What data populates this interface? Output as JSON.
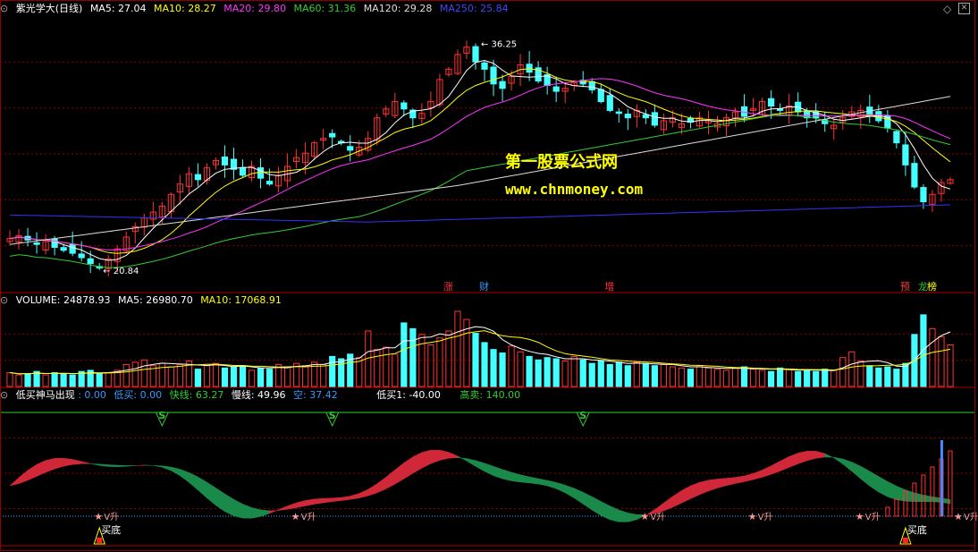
{
  "panel1": {
    "title": "紫光学大(日线)",
    "ma": [
      {
        "label": "MA5: 27.04",
        "color": "#ffffff"
      },
      {
        "label": "MA10: 28.27",
        "color": "#ffff00"
      },
      {
        "label": "MA20: 29.80",
        "color": "#ff33ff"
      },
      {
        "label": "MA60: 31.36",
        "color": "#33cc33"
      },
      {
        "label": "MA120: 29.28",
        "color": "#dddddd"
      },
      {
        "label": "MA250: 25.84",
        "color": "#3333ff"
      }
    ],
    "high_label": "36.25",
    "low_label": "20.84",
    "events": [
      {
        "label": "涨",
        "color": "#ff3333",
        "idx": 49
      },
      {
        "label": "财",
        "color": "#3399ff",
        "idx": 53
      },
      {
        "label": "增",
        "color": "#ff3333",
        "idx": 67
      },
      {
        "label": "预",
        "color": "#ff3333",
        "idx": 100
      },
      {
        "label": "龙",
        "color": "#33cc33",
        "idx": 102
      },
      {
        "label": "榜",
        "color": "#ffff00",
        "idx": 103
      }
    ]
  },
  "panel2": {
    "items": [
      {
        "label": "VOLUME: 24878.93",
        "color": "#ffffff"
      },
      {
        "label": "MA5: 26980.70",
        "color": "#ffffff"
      },
      {
        "label": "MA10: 17068.91",
        "color": "#ffff00"
      }
    ]
  },
  "panel3": {
    "items": [
      {
        "label": "低买神马出现",
        "color": "#ffffff"
      },
      {
        "label": ": 0.00",
        "color": "#3399ff"
      },
      {
        "label": "低买: 0.00",
        "color": "#3399ff"
      },
      {
        "label": "快线: 63.27",
        "color": "#33cc33"
      },
      {
        "label": "慢线: 49.96",
        "color": "#ffffff"
      },
      {
        "label": "空: 37.42",
        "color": "#3399ff"
      },
      {
        "label": "低买1: -40.00",
        "color": "#ffffff"
      },
      {
        "label": "高卖: 140.00",
        "color": "#33cc33"
      }
    ],
    "s_label": "S",
    "s_idx": [
      17,
      36,
      64
    ],
    "v_label": "V升",
    "v_idx": [
      10,
      32,
      71,
      83,
      95,
      106
    ],
    "buy_label": "买底",
    "buy_idx": [
      10,
      100
    ]
  },
  "watermark": {
    "line1": "第一股票公式网",
    "line2": "www.chnmoney.com"
  },
  "colors": {
    "up": "#ff3333",
    "down": "#44ffff",
    "grid": "#8b0000"
  },
  "chart_data": {
    "type": "candlestick",
    "title": "紫光学大(日线)",
    "y_high": 36.25,
    "y_low": 20.84,
    "ylim": [
      20.0,
      37.5
    ],
    "close": [
      23.0,
      23.2,
      22.9,
      22.6,
      22.8,
      22.4,
      22.2,
      22.0,
      21.7,
      21.3,
      21.0,
      21.6,
      22.3,
      23.1,
      23.8,
      24.4,
      24.8,
      25.2,
      26.0,
      26.7,
      27.4,
      27.0,
      27.8,
      28.3,
      28.0,
      27.7,
      27.3,
      27.9,
      27.1,
      26.7,
      27.3,
      27.9,
      28.5,
      28.8,
      29.5,
      29.8,
      29.9,
      29.5,
      29.0,
      29.2,
      29.8,
      31.2,
      31.8,
      32.3,
      31.8,
      31.2,
      31.5,
      32.3,
      33.8,
      34.5,
      35.5,
      36.0,
      35.0,
      34.5,
      33.5,
      33.2,
      34.0,
      34.8,
      34.3,
      33.7,
      33.4,
      33.0,
      33.2,
      33.6,
      33.5,
      33.1,
      32.3,
      31.7,
      31.5,
      31.2,
      31.7,
      31.2,
      30.7,
      31.0,
      31.2,
      30.8,
      30.9,
      31.2,
      31.0,
      30.8,
      31.2,
      31.6,
      31.3,
      31.8,
      32.3,
      32.0,
      31.7,
      32.0,
      31.6,
      31.2,
      31.2,
      30.8,
      30.7,
      31.2,
      31.6,
      31.7,
      31.3,
      31.0,
      30.5,
      29.5,
      28.0,
      26.5,
      25.5,
      26.0,
      26.8,
      27.0
    ]
  },
  "volume_data": [
    1.2,
    1.0,
    1.1,
    1.3,
    1.0,
    1.2,
    1.1,
    1.0,
    1.3,
    1.4,
    1.1,
    1.2,
    1.4,
    1.9,
    2.1,
    2.3,
    1.8,
    2.0,
    1.7,
    1.9,
    2.2,
    1.5,
    1.8,
    2.0,
    1.6,
    1.7,
    1.8,
    1.4,
    1.6,
    1.5,
    1.9,
    1.7,
    2.0,
    1.8,
    2.1,
    1.9,
    2.6,
    2.4,
    2.8,
    2.5,
    4.8,
    3.2,
    3.4,
    2.8,
    5.5,
    5.0,
    4.5,
    3.6,
    4.2,
    4.8,
    6.5,
    5.8,
    4.6,
    3.8,
    3.2,
    2.9,
    3.5,
    3.0,
    2.6,
    2.3,
    2.5,
    2.4,
    2.2,
    2.6,
    2.3,
    2.0,
    2.2,
    1.9,
    2.1,
    1.8,
    2.1,
    2.0,
    1.8,
    1.9,
    1.7,
    1.6,
    1.5,
    1.8,
    1.6,
    1.5,
    1.4,
    1.6,
    1.7,
    1.5,
    1.4,
    1.3,
    1.6,
    1.5,
    1.3,
    1.4,
    1.3,
    1.5,
    1.4,
    2.5,
    3.0,
    2.2,
    1.8,
    1.6,
    1.7,
    1.5,
    2.0,
    4.5,
    6.2,
    5.0,
    4.3,
    3.6
  ]
}
